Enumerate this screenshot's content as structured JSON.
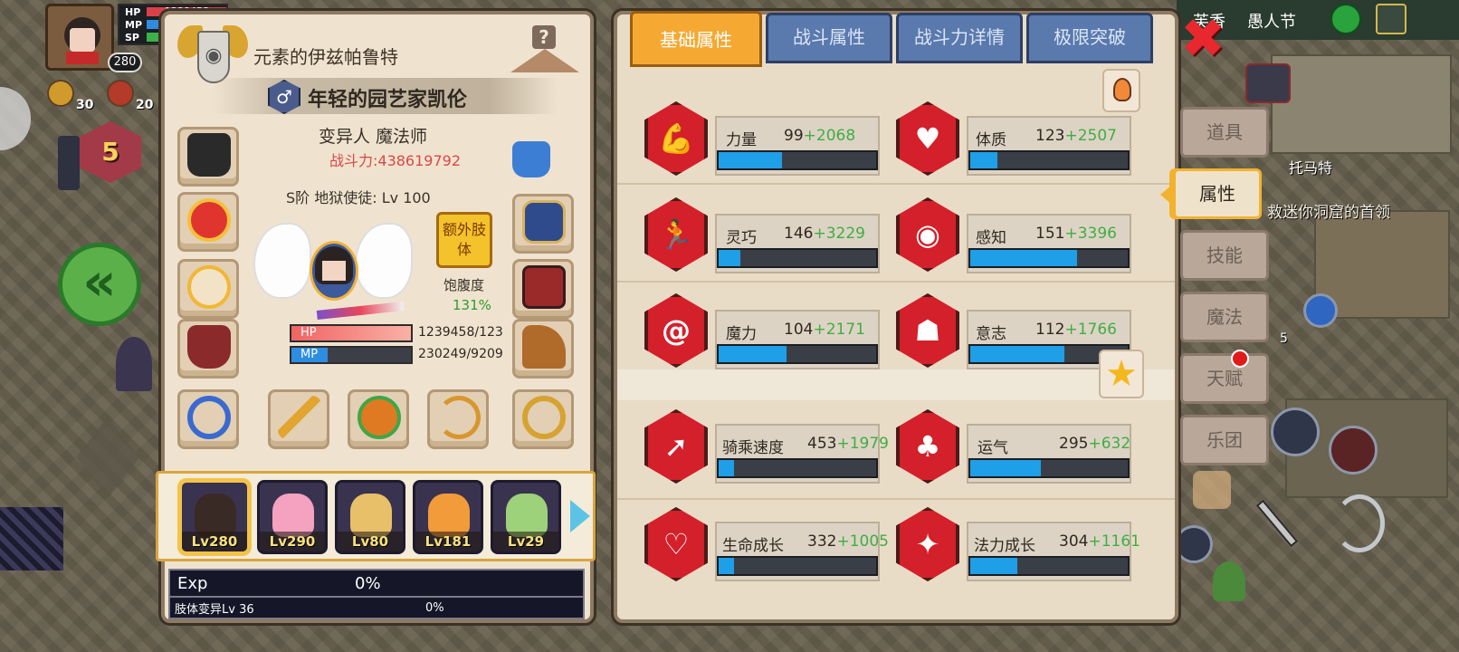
{
  "hud": {
    "hp_label": "HP",
    "mp_label": "MP",
    "sp_label": "SP",
    "hp_value": "1239458",
    "level": "280",
    "icon1_count": "30",
    "icon2_count": "20",
    "stage_number": "5"
  },
  "character": {
    "title": "元素的伊兹帕鲁特",
    "name": "年轻的园艺家凯伦",
    "gender_symbol": "♂",
    "race_class": "变异人 魔法师",
    "power": "战斗力:438619792",
    "rank": "S阶 地狱使徒: Lv 100",
    "extra_limb_button": "额外肢体",
    "satiety_label": "饱腹度",
    "satiety_value": "131%",
    "hp_label": "HP",
    "hp_value": "1239458/123",
    "mp_label": "MP",
    "mp_value": "230249/9209",
    "hp_fill": 1.0,
    "mp_fill": 0.3
  },
  "party": [
    {
      "level": "Lv280",
      "color": "#f0b84a",
      "selected": true
    },
    {
      "level": "Lv290",
      "color": "#f4a2c0",
      "selected": false
    },
    {
      "level": "Lv80",
      "color": "#e8c06a",
      "selected": false
    },
    {
      "level": "Lv181",
      "color": "#f29b3a",
      "selected": false
    },
    {
      "level": "Lv29",
      "color": "#9ed27a",
      "selected": false
    }
  ],
  "exp": {
    "label": "Exp",
    "percent": "0%",
    "limb_label": "肢体变异Lv 36",
    "limb_percent": "0%"
  },
  "tabs": [
    {
      "label": "基础属性",
      "active": true
    },
    {
      "label": "战斗属性",
      "active": false
    },
    {
      "label": "战斗力详情",
      "active": false
    },
    {
      "label": "极限突破",
      "active": false
    }
  ],
  "stats": {
    "strength": {
      "name": "力量",
      "base": "99",
      "bonus": "+2068",
      "fill": 0.4,
      "icon": "muscle-icon"
    },
    "vitality": {
      "name": "体质",
      "base": "123",
      "bonus": "+2507",
      "fill": 0.17,
      "icon": "body-icon"
    },
    "agility": {
      "name": "灵巧",
      "base": "146",
      "bonus": "+3229",
      "fill": 0.14,
      "icon": "runner-icon"
    },
    "perception": {
      "name": "感知",
      "base": "151",
      "bonus": "+3396",
      "fill": 0.68,
      "icon": "eye-icon"
    },
    "magic": {
      "name": "魔力",
      "base": "104",
      "bonus": "+2171",
      "fill": 0.43,
      "icon": "spiral-icon"
    },
    "will": {
      "name": "意志",
      "base": "112",
      "bonus": "+1766",
      "fill": 0.6,
      "icon": "head-icon"
    },
    "riding": {
      "name": "骑乘速度",
      "base": "453",
      "bonus": "+1979",
      "fill": 0.1,
      "icon": "speed-icon"
    },
    "luck": {
      "name": "运气",
      "base": "295",
      "bonus": "+632",
      "fill": 0.45,
      "icon": "clover-icon"
    },
    "hp_growth": {
      "name": "生命成长",
      "base": "332",
      "bonus": "+1005",
      "fill": 0.1,
      "icon": "heart-icon"
    },
    "mp_growth": {
      "name": "法力成长",
      "base": "304",
      "bonus": "+1161",
      "fill": 0.3,
      "icon": "mp-growth-icon"
    }
  },
  "side_nav": [
    {
      "label": "道具",
      "active": false
    },
    {
      "label": "属性",
      "active": true
    },
    {
      "label": "技能",
      "active": false
    },
    {
      "label": "魔法",
      "active": false
    },
    {
      "label": "天赋",
      "active": false,
      "alert": true
    },
    {
      "label": "乐团",
      "active": false
    }
  ],
  "map": {
    "top_text_1": "芙香",
    "top_text_2": "愚人节",
    "npc_name": "托马特",
    "quest_text": "救迷你洞窟的首领",
    "item_count": "5"
  },
  "colors": {
    "accent": "#f5a933",
    "tab_blue": "#5a79ad",
    "stat_red": "#d3202a",
    "bar_blue": "#1e9fe8",
    "bonus_green": "#3fae43",
    "power_red": "#d94848"
  }
}
